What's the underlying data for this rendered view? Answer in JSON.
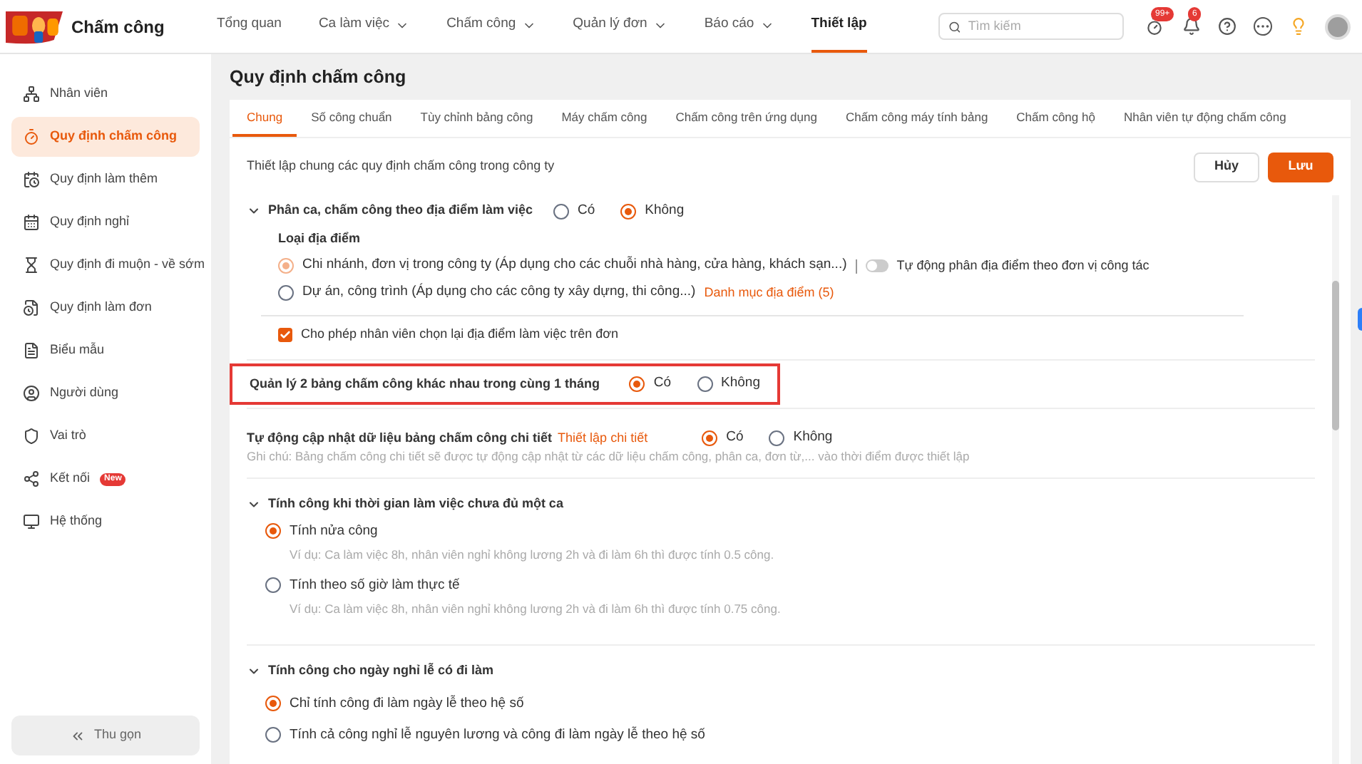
{
  "app": {
    "title": "Chấm công"
  },
  "nav": [
    {
      "label": "Tổng quan",
      "dropdown": false,
      "selected": false
    },
    {
      "label": "Ca làm việc",
      "dropdown": true,
      "selected": false
    },
    {
      "label": "Chấm công",
      "dropdown": true,
      "selected": false
    },
    {
      "label": "Quản lý đơn",
      "dropdown": true,
      "selected": false
    },
    {
      "label": "Báo cáo",
      "dropdown": true,
      "selected": false
    },
    {
      "label": "Thiết lập",
      "dropdown": false,
      "selected": true
    }
  ],
  "search": {
    "placeholder": "Tìm kiếm"
  },
  "header_badges": [
    {
      "kind": "timer",
      "badge": "99+"
    },
    {
      "kind": "bell",
      "badge": "6"
    }
  ],
  "sidebar": {
    "items": [
      {
        "kind": "people",
        "label": "Nhân viên",
        "selected": false
      },
      {
        "kind": "timer",
        "label": "Quy định chấm công",
        "selected": true
      },
      {
        "kind": "calendar-clock",
        "label": "Quy định làm thêm",
        "selected": false
      },
      {
        "kind": "calendar",
        "label": "Quy định nghỉ",
        "selected": false
      },
      {
        "kind": "hourglass",
        "label": "Quy định đi muộn - về sớm",
        "selected": false
      },
      {
        "kind": "file-clock",
        "label": "Quy định làm đơn",
        "selected": false
      },
      {
        "kind": "form",
        "label": "Biểu mẫu",
        "selected": false
      },
      {
        "kind": "user",
        "label": "Người dùng",
        "selected": false
      },
      {
        "kind": "shield",
        "label": "Vai trò",
        "selected": false
      },
      {
        "kind": "share",
        "label": "Kết nối",
        "selected": false,
        "badge": "New"
      },
      {
        "kind": "monitor",
        "label": "Hệ thống",
        "selected": false
      }
    ],
    "collapse": "Thu gọn"
  },
  "page_title": "Quy định chấm công",
  "tabs": [
    {
      "label": "Chung",
      "selected": true
    },
    {
      "label": "Số công chuẩn",
      "selected": false
    },
    {
      "label": "Tùy chỉnh bảng công",
      "selected": false
    },
    {
      "label": "Máy chấm công",
      "selected": false
    },
    {
      "label": "Chấm công trên ứng dụng",
      "selected": false
    },
    {
      "label": "Chấm công máy tính bảng",
      "selected": false
    },
    {
      "label": "Chấm công hộ",
      "selected": false
    },
    {
      "label": "Nhân viên tự động chấm công",
      "selected": false
    }
  ],
  "description": "Thiết lập chung các quy định chấm công trong công ty",
  "buttons": {
    "cancel": "Hủy",
    "save": "Lưu"
  },
  "location_section": {
    "title": "Phân ca, chấm công theo địa điểm làm việc",
    "expanded": true,
    "options": [
      {
        "label": "Có",
        "selected": false
      },
      {
        "label": "Không",
        "selected": true
      }
    ],
    "type_title": "Loại địa điểm",
    "type_options": [
      {
        "label": "Chi nhánh, đơn vị trong công ty (Áp dụng cho các chuỗi nhà hàng, cửa hàng, khách sạn...)",
        "selected": true,
        "disabled": true,
        "toggle": {
          "label": "Tự động phân địa điểm theo đơn vị công tác",
          "on": false
        }
      },
      {
        "label": "Dự án, công trình (Áp dụng cho các công ty xây dựng, thi công...)",
        "selected": false,
        "disabled": false,
        "link": "Danh mục địa điểm (5)"
      }
    ],
    "checkbox": {
      "label": "Cho phép nhân viên chọn lại địa điểm làm việc trên đơn",
      "checked": true
    }
  },
  "rows": [
    {
      "label": "Quản lý 2 bảng chấm công khác nhau trong cùng 1 tháng",
      "highlighted": true,
      "options": [
        {
          "label": "Có",
          "selected": true
        },
        {
          "label": "Không",
          "selected": false
        }
      ]
    },
    {
      "label": "Tự động cập nhật dữ liệu bảng chấm công chi tiết",
      "link": "Thiết lập chi tiết",
      "highlighted": false,
      "options": [
        {
          "label": "Có",
          "selected": true
        },
        {
          "label": "Không",
          "selected": false
        }
      ],
      "note": "Ghi chú: Bảng chấm công chi tiết sẽ được tự động cập nhật từ các dữ liệu chấm công, phân ca, đơn từ,... vào thời điểm được thiết lập"
    }
  ],
  "sections": [
    {
      "title": "Tính công khi thời gian làm việc chưa đủ một ca",
      "expanded": true,
      "options": [
        {
          "label": "Tính nửa công",
          "selected": true,
          "example": "Ví dụ: Ca làm việc 8h, nhân viên nghỉ không lương 2h và đi làm 6h thì được tính 0.5 công."
        },
        {
          "label": "Tính theo số giờ làm thực tế",
          "selected": false,
          "example": "Ví dụ: Ca làm việc 8h, nhân viên nghỉ không lương 2h và đi làm 6h thì được tính 0.75 công."
        }
      ]
    },
    {
      "title": "Tính công cho ngày nghỉ lễ có đi làm",
      "expanded": true,
      "options": [
        {
          "label": "Chỉ tính công đi làm ngày lễ theo hệ số",
          "selected": true
        },
        {
          "label": "Tính cả công nghỉ lễ nguyên lương và công đi làm ngày lễ theo hệ số",
          "selected": false
        }
      ]
    }
  ]
}
